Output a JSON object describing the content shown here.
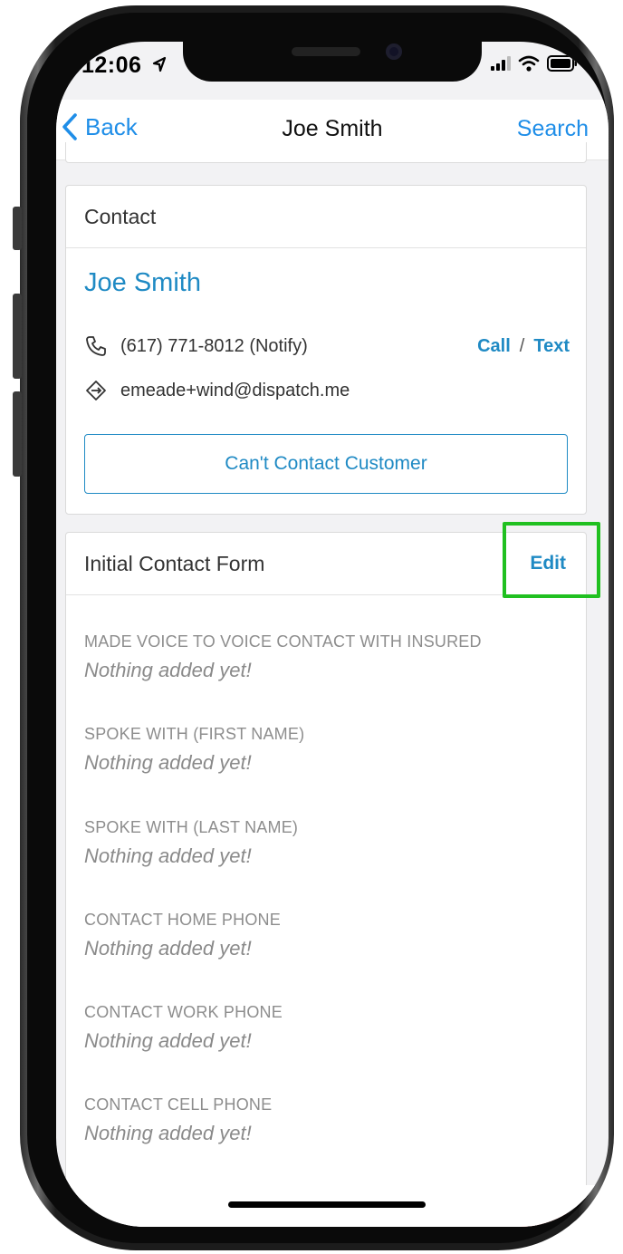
{
  "status_bar": {
    "time": "12:06"
  },
  "navbar": {
    "back_label": "Back",
    "title": "Joe Smith",
    "search_label": "Search"
  },
  "contact_card": {
    "header": "Contact",
    "name": "Joe Smith",
    "phone": "(617) 771-8012 (Notify)",
    "call_label": "Call",
    "separator": "/",
    "text_label": "Text",
    "email": "emeade+wind@dispatch.me",
    "cant_contact_label": "Can't Contact Customer"
  },
  "form_card": {
    "header": "Initial Contact Form",
    "edit_label": "Edit",
    "fields": [
      {
        "label": "MADE VOICE TO VOICE CONTACT WITH INSURED",
        "value": "Nothing added yet!"
      },
      {
        "label": "SPOKE WITH (FIRST NAME)",
        "value": "Nothing added yet!"
      },
      {
        "label": "SPOKE WITH (LAST NAME)",
        "value": "Nothing added yet!"
      },
      {
        "label": "CONTACT HOME PHONE",
        "value": "Nothing added yet!"
      },
      {
        "label": "CONTACT WORK PHONE",
        "value": "Nothing added yet!"
      },
      {
        "label": "CONTACT CELL PHONE",
        "value": "Nothing added yet!"
      }
    ]
  },
  "colors": {
    "accent": "#1f8ac4",
    "ios_blue": "#1f8ee8",
    "fab": "#e05a5a",
    "highlight": "#20c020"
  },
  "icons": [
    "location-arrow-icon",
    "signal-icon",
    "wifi-icon",
    "battery-icon",
    "chevron-left-icon",
    "phone-icon",
    "tag-icon",
    "plus-icon"
  ]
}
